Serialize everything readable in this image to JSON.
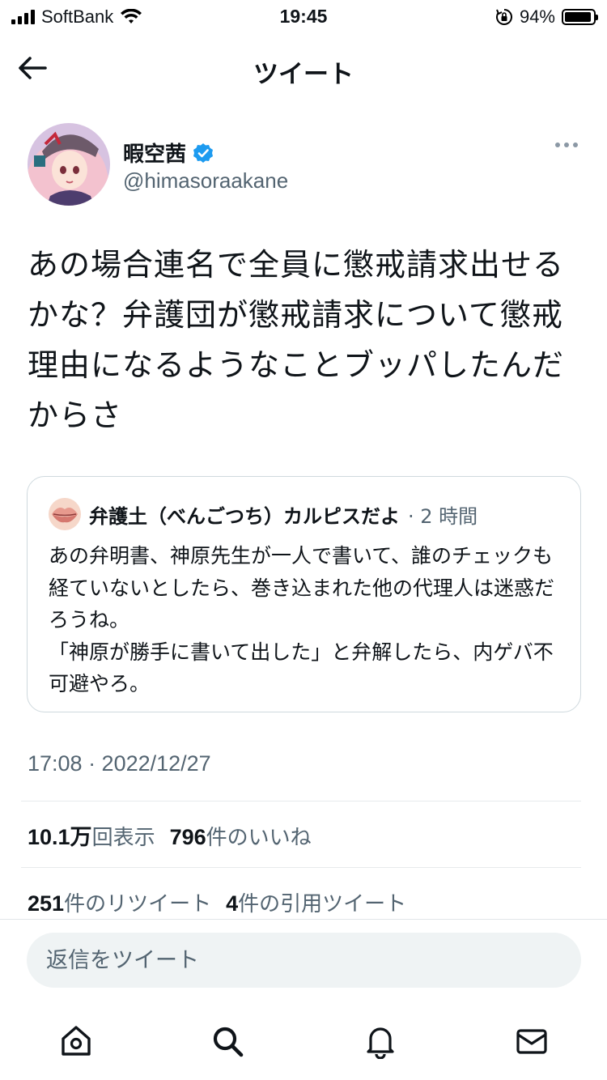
{
  "status_bar": {
    "carrier": "SoftBank",
    "time": "19:45",
    "battery": "94%",
    "battery_level": 0.94
  },
  "nav": {
    "title": "ツイート",
    "back_icon": "arrow-left-icon"
  },
  "author": {
    "name": "暇空茜",
    "handle": "@himasoraakane",
    "verified": true
  },
  "tweet": {
    "text": "あの場合連名で全員に懲戒請求出せるかな？弁護団が懲戒請求について懲戒理由になるようなことブッパしたんだからさ"
  },
  "quote": {
    "name": "弁護土（べんごつち）カルピスだよ",
    "time": "· 2 時間",
    "text": "あの弁明書、神原先生が一人で書いて、誰のチェックも経ていないとしたら、巻き込まれた他の代理人は迷惑だろうね。\n「神原が勝手に書いて出した」と弁解したら、内ゲバ不可避やろ。"
  },
  "meta": {
    "timestamp": "17:08 · 2022/12/27",
    "views_count": "10.1万",
    "views_label": "回表示",
    "likes_count": "796",
    "likes_label": "件のいいね",
    "retweets_count": "251",
    "retweets_label": "件のリツイート",
    "quotes_count": "4",
    "quotes_label": "件の引用ツイート"
  },
  "reply": {
    "placeholder": "返信をツイート"
  },
  "tab_bar": {
    "items": [
      "home-icon",
      "search-icon",
      "notifications-icon",
      "messages-icon"
    ]
  },
  "colors": {
    "accent": "#1d9bf0",
    "secondary_text": "#536471",
    "border": "#cfd9de",
    "reply_bg": "#eff3f4"
  }
}
